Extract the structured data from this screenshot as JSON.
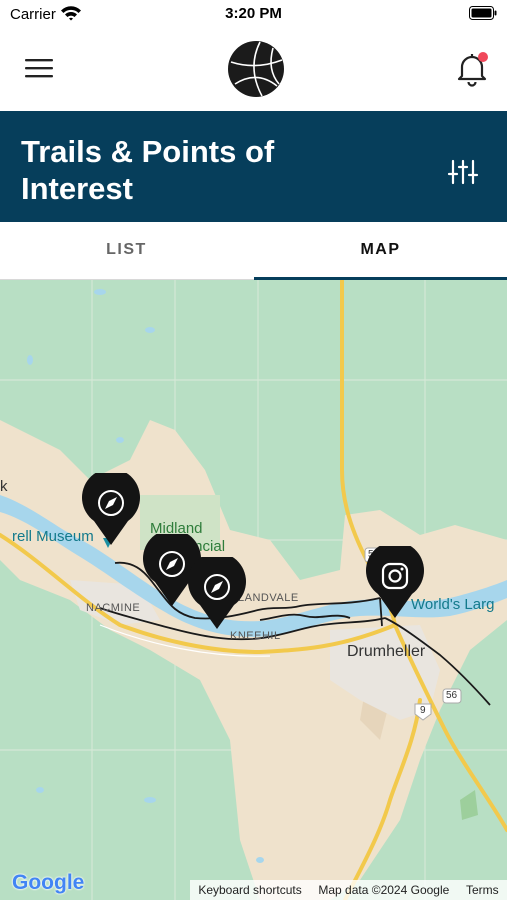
{
  "status_bar": {
    "carrier": "Carrier",
    "time": "3:20 PM",
    "icons": [
      "wifi-icon",
      "battery-icon"
    ]
  },
  "header": {
    "menu_icon": "hamburger-menu-icon",
    "logo_icon": "basketball-logo-icon",
    "notification_icon": "bell-icon",
    "notification_dot_color": "#f0485a"
  },
  "title_band": {
    "title": "Trails & Points of Interest",
    "filter_icon": "sliders-icon",
    "background": "#063e5b"
  },
  "tabs": [
    {
      "label": "LIST",
      "active": false
    },
    {
      "label": "MAP",
      "active": true
    }
  ],
  "map": {
    "labels": {
      "museum": "rell Museum",
      "midland": "Midland",
      "provincial": "Provincial",
      "nacmine": "NACMINE",
      "rosedale": "LANDVALE",
      "kneehill": "KNEEHIL",
      "drumheller": "Drumheller",
      "worlds_largest": "World's Larg",
      "k_label": "k",
      "road_56_north": "56",
      "road_56_south": "56",
      "road_9": "9"
    },
    "pins": [
      {
        "icon": "compass-icon"
      },
      {
        "icon": "compass-icon"
      },
      {
        "icon": "compass-icon"
      },
      {
        "icon": "instagram-icon"
      }
    ],
    "google_logo": "Google",
    "attribution": {
      "shortcuts": "Keyboard shortcuts",
      "data": "Map data ©2024 Google",
      "terms": "Terms"
    }
  }
}
